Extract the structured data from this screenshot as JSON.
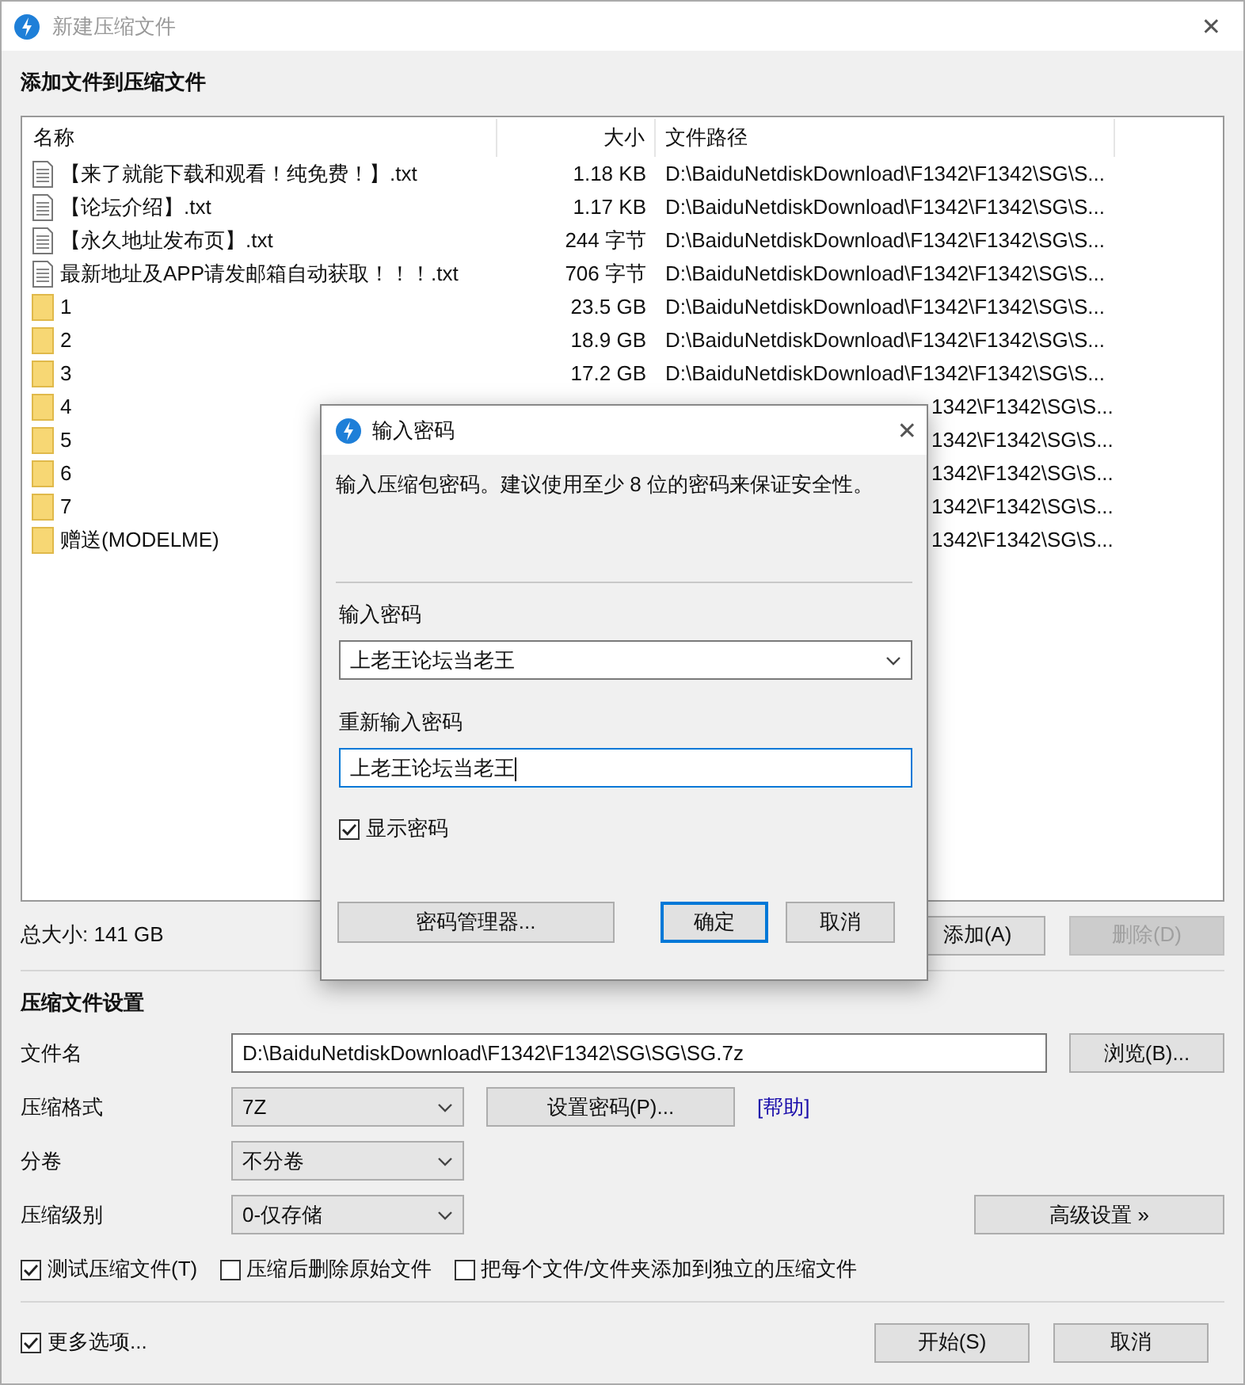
{
  "window": {
    "title": "新建压缩文件",
    "close": "✕"
  },
  "files": {
    "title": "添加文件到压缩文件",
    "columns": [
      "名称",
      "大小",
      "文件路径"
    ],
    "rows": [
      {
        "kind": "file",
        "name": "【来了就能下载和观看！纯免费！】.txt",
        "size": "1.18 KB",
        "path": "D:\\BaiduNetdiskDownload\\F1342\\F1342\\SG\\S..."
      },
      {
        "kind": "file",
        "name": "【论坛介绍】.txt",
        "size": "1.17 KB",
        "path": "D:\\BaiduNetdiskDownload\\F1342\\F1342\\SG\\S..."
      },
      {
        "kind": "file",
        "name": "【永久地址发布页】.txt",
        "size": "244 字节",
        "path": "D:\\BaiduNetdiskDownload\\F1342\\F1342\\SG\\S..."
      },
      {
        "kind": "file",
        "name": "最新地址及APP请发邮箱自动获取！！！.txt",
        "size": "706 字节",
        "path": "D:\\BaiduNetdiskDownload\\F1342\\F1342\\SG\\S..."
      },
      {
        "kind": "folder",
        "name": "1",
        "size": "23.5 GB",
        "path": "D:\\BaiduNetdiskDownload\\F1342\\F1342\\SG\\S..."
      },
      {
        "kind": "folder",
        "name": "2",
        "size": "18.9 GB",
        "path": "D:\\BaiduNetdiskDownload\\F1342\\F1342\\SG\\S..."
      },
      {
        "kind": "folder",
        "name": "3",
        "size": "17.2 GB",
        "path": "D:\\BaiduNetdiskDownload\\F1342\\F1342\\SG\\S..."
      },
      {
        "kind": "folder",
        "name": "4",
        "path": "1342\\F1342\\SG\\S..."
      },
      {
        "kind": "folder",
        "name": "5",
        "path": "1342\\F1342\\SG\\S..."
      },
      {
        "kind": "folder",
        "name": "6",
        "path": "1342\\F1342\\SG\\S..."
      },
      {
        "kind": "folder",
        "name": "7",
        "path": "1342\\F1342\\SG\\S..."
      },
      {
        "kind": "folder",
        "name": "赠送(MODELME)",
        "path": "1342\\F1342\\SG\\S..."
      }
    ],
    "total": "总大小: 141 GB",
    "buttons": [
      {
        "label": "添加(A)",
        "disabled": false
      },
      {
        "label": "删除(D)",
        "disabled": true
      }
    ]
  },
  "settings": {
    "title": "压缩文件设置",
    "filename": {
      "label": "文件名",
      "value": "D:\\BaiduNetdiskDownload\\F1342\\F1342\\SG\\SG\\SG.7z",
      "button": "浏览(B)..."
    },
    "format": {
      "label": "压缩格式",
      "value": "7Z",
      "button": "设置密码(P)...",
      "link": "[帮助]"
    },
    "volume": {
      "label": "分卷",
      "value": "不分卷"
    },
    "level": {
      "label": "压缩级别",
      "value": "0-仅存储",
      "button": "高级设置 »"
    },
    "options": [
      {
        "label": "测试压缩文件(T)",
        "checked": true
      },
      {
        "label": "压缩后删除原始文件",
        "checked": false
      },
      {
        "label": "把每个文件/文件夹添加到独立的压缩文件",
        "checked": false
      }
    ],
    "more_options": {
      "label": "更多选项...",
      "checked": true
    },
    "buttons": [
      "开始(S)",
      "取消"
    ]
  },
  "dialog": {
    "title": "输入密码",
    "close": "✕",
    "hint": "输入压缩包密码。建议使用至少 8 位的密码来保证安全性。",
    "password": {
      "label": "输入密码",
      "value": "上老王论坛当老王"
    },
    "confirm": {
      "label": "重新输入密码",
      "value": "上老王论坛当老王",
      "focused": true
    },
    "show_password": {
      "label": "显示密码",
      "checked": true
    },
    "buttons": [
      {
        "label": "密码管理器...",
        "kind": "wide",
        "default": false
      },
      {
        "label": "确定",
        "kind": "normal",
        "default": true
      },
      {
        "label": "取消",
        "kind": "normal",
        "default": false
      }
    ]
  }
}
